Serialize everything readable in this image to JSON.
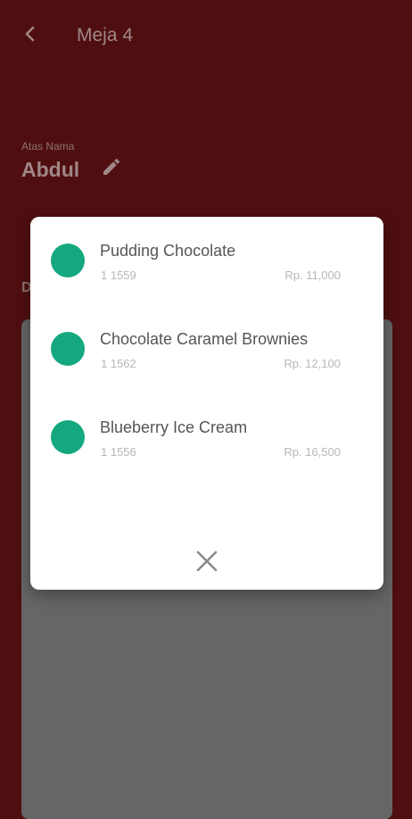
{
  "app_bar": {
    "title": "Meja 4",
    "back_icon": "back-arrow-icon"
  },
  "customer": {
    "caption": "Atas Nama",
    "name": "Abdul",
    "edit_icon": "pencil-icon"
  },
  "section": {
    "letter": "D"
  },
  "dialog": {
    "items": [
      {
        "name": "Pudding Chocolate",
        "code": "1 1559",
        "price": "Rp. 11,000",
        "dot_color": "#15a87e"
      },
      {
        "name": "Chocolate Caramel Brownies",
        "code": "1 1562",
        "price": "Rp. 12,100",
        "dot_color": "#15a87e"
      },
      {
        "name": "Blueberry Ice Cream",
        "code": "1 1556",
        "price": "Rp. 16,500",
        "dot_color": "#15a87e"
      }
    ],
    "close_icon": "close-icon"
  },
  "colors": {
    "scrim_bg": "#4f0f10",
    "accent_green": "#15a87e",
    "card_gray": "#666666"
  }
}
